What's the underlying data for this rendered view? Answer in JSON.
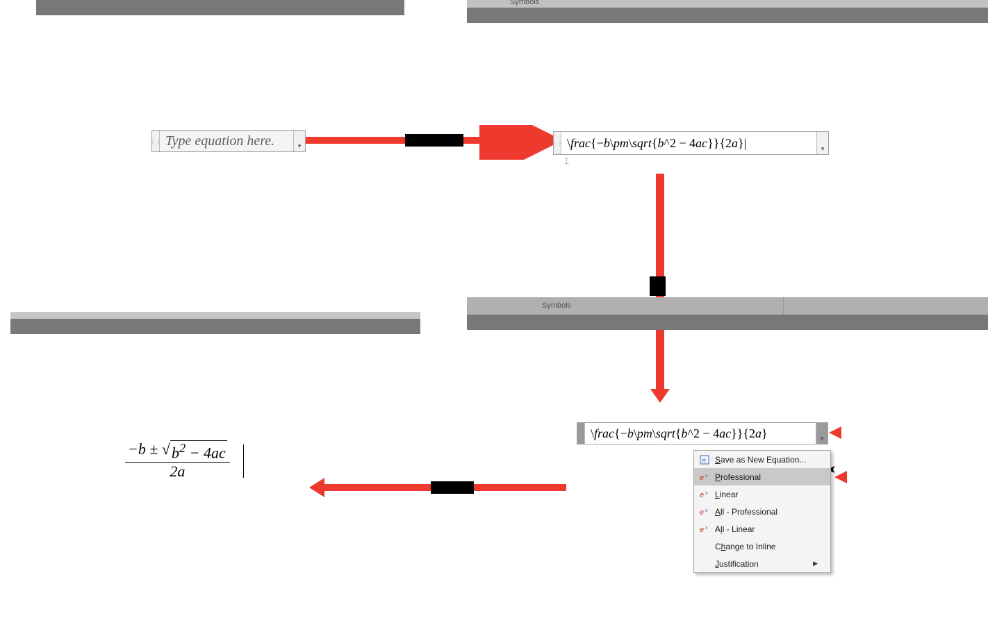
{
  "ribbon": {
    "symbols_label": "Symbols"
  },
  "eq_placeholder": {
    "text": "Type equation here."
  },
  "eq_latex": {
    "raw": "\\frac{−b\\pm\\sqrt{b^2 − 4ac}}{2a}"
  },
  "eq_rendered": {
    "numerator_prefix": "−b ± ",
    "radicand_html": "b<sup>2</sup> − 4ac",
    "denominator": "2a"
  },
  "context_menu": {
    "save_html": "<span class='und'>S</span>ave as New Equation...",
    "professional_html": "<span class='und'>P</span>rofessional",
    "linear_html": "<span class='und'>L</span>inear",
    "all_professional_html": "<span class='und'>A</span>ll - Professional",
    "all_linear_html": "A<span class='und'>l</span>l - Linear",
    "change_inline_html": "C<span class='und'>h</span>ange to Inline",
    "justification_html": "<span class='und'>J</span>ustification"
  }
}
